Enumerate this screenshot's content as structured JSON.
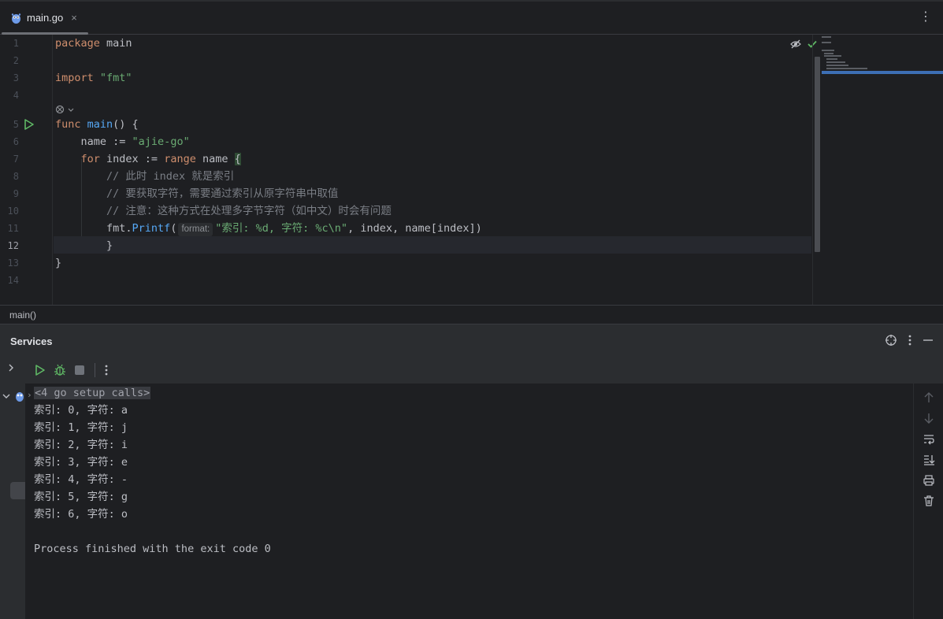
{
  "tab": {
    "label": "main.go",
    "close": "×",
    "menu": "⋮"
  },
  "editor": {
    "line_numbers": [
      "1",
      "2",
      "3",
      "4",
      "5",
      "6",
      "7",
      "8",
      "9",
      "10",
      "11",
      "12",
      "13",
      "14"
    ],
    "active_line": "12",
    "code": {
      "l1_kw": "package",
      "l1_name": " main",
      "l3_kw": "import",
      "l3_str": " \"fmt\"",
      "l5_kw": "func",
      "l5_fn": " main",
      "l5_rest": "() {",
      "l6_var": "    name := ",
      "l6_str": "\"ajie-go\"",
      "l7_kw1": "    for",
      "l7_mid": " index := ",
      "l7_kw2": "range",
      "l7_name": " name ",
      "l7_brace": "{",
      "l8": "        // 此时 index 就是索引",
      "l9": "        // 要获取字符，需要通过索引从原字符串中取值",
      "l10": "        // 注意：这种方式在处理多字节字符（如中文）时会有问题",
      "l11_pre": "        fmt.",
      "l11_fn": "Printf",
      "l11_open": "(",
      "l11_hint": "format:",
      "l11_str": "\"索引: %d, 字符: %c\\n\"",
      "l11_rest": ", index, name[index])",
      "l12_brace": "        }",
      "l13": "}"
    }
  },
  "breadcrumb": "main()",
  "services": {
    "title": "Services",
    "console": {
      "setup": "<4 go setup calls>",
      "lines": [
        "索引: 0, 字符: a",
        "索引: 1, 字符: j",
        "索引: 2, 字符: i",
        "索引: 3, 字符: e",
        "索引: 4, 字符: -",
        "索引: 5, 字符: g",
        "索引: 6, 字符: o"
      ],
      "finish": "Process finished with the exit code 0"
    }
  },
  "colors": {
    "keyword": "#cf8e6d",
    "function": "#56a8f5",
    "string": "#6aab73",
    "comment": "#7a7e85",
    "run_green": "#5fb865"
  }
}
